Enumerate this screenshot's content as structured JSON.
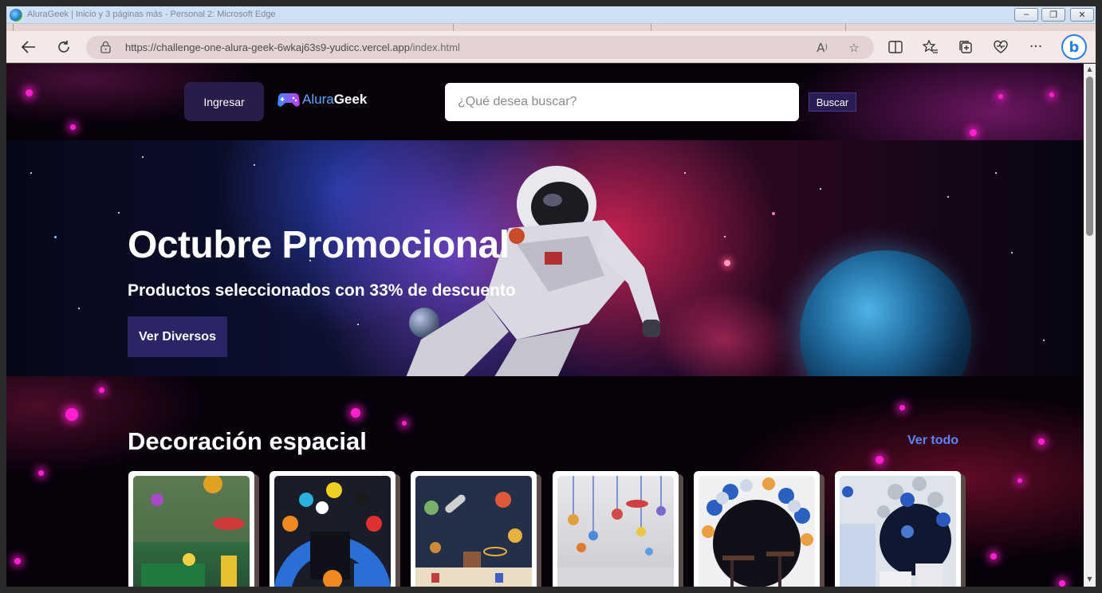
{
  "browser": {
    "window_title": "AluraGeek | Inicio y 3 páginas más - Personal 2: Microsoft Edge",
    "url_main": "https://challenge-one-alura-geek-6wkaj63s9-yudicc.vercel.app",
    "url_path": "/index.html",
    "window_buttons": {
      "minimize": "–",
      "restore": "❐",
      "close": "✕"
    },
    "icons": [
      "back-icon",
      "refresh-icon",
      "lock-icon",
      "read-aloud-icon",
      "favorite-star-icon",
      "split-screen-icon",
      "favorites-icon",
      "collections-icon",
      "browser-essentials-icon",
      "more-icon",
      "bing-icon"
    ]
  },
  "header": {
    "login_label": "Ingresar",
    "logo_text_a": "Alura",
    "logo_text_b": "Geek",
    "search_placeholder": "¿Qué desea buscar?",
    "search_button": "Buscar"
  },
  "hero": {
    "title": "Octubre Promocional",
    "subtitle": "Productos seleccionados con 33% de descuento",
    "cta": "Ver Diversos"
  },
  "section": {
    "title": "Decoración espacial",
    "view_all": "Ver todo",
    "product_count": 6
  },
  "colors": {
    "accent_link": "#5a86ff",
    "button_dark": "#2b2466",
    "neon_pink": "#ff1fd0"
  }
}
